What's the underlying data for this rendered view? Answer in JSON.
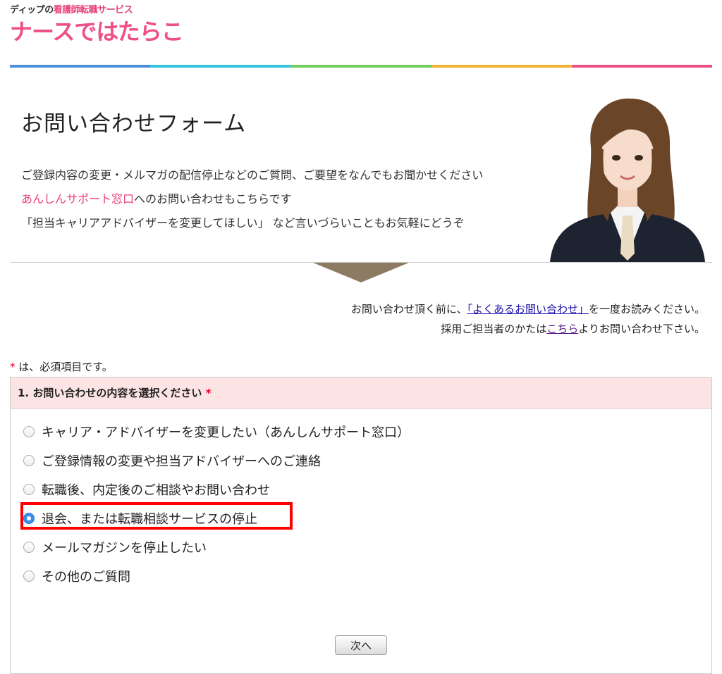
{
  "logo": {
    "tagline_prefix": "ディップの",
    "tagline_highlight": "看護師転職サービス",
    "name": "ナースではたらこ"
  },
  "color_bar": [
    "#4a90d9",
    "#35c4e0",
    "#6fcf5a",
    "#f2b233",
    "#ee4f88"
  ],
  "hero": {
    "title": "お問い合わせフォーム",
    "line1": "ご登録内容の変更・メルマガの配信停止などのご質問、ご要望をなんでもお聞かせください",
    "line2_highlight": "あんしんサポート窓口",
    "line2_rest": "へのお問い合わせもこちらです",
    "line3": "「担当キャリアアドバイザーを変更してほしい」 など言いづらいこともお気軽にどうぞ"
  },
  "notice": {
    "faq_prefix": "お問い合わせ頂く前に、",
    "faq_link": "「よくあるお問い合わせ」",
    "faq_suffix": "を一度お読みください。",
    "employer_prefix": "採用ご担当者のかたは",
    "employer_link": "こちら",
    "employer_suffix": "よりお問い合わせ下さい。"
  },
  "required_note": {
    "star": "*",
    "text": " は、必須項目です。"
  },
  "question": {
    "label": "1. お問い合わせの内容を選択ください",
    "star": "*",
    "options": [
      "キャリア・アドバイザーを変更したい（あんしんサポート窓口）",
      "ご登録情報の変更や担当アドバイザーへのご連絡",
      "転職後、内定後のご相談やお問い合わせ",
      "退会、または転職相談サービスの停止",
      "メールマガジンを停止したい",
      "その他のご質問"
    ],
    "selected_index": 3
  },
  "next_button": "次へ"
}
